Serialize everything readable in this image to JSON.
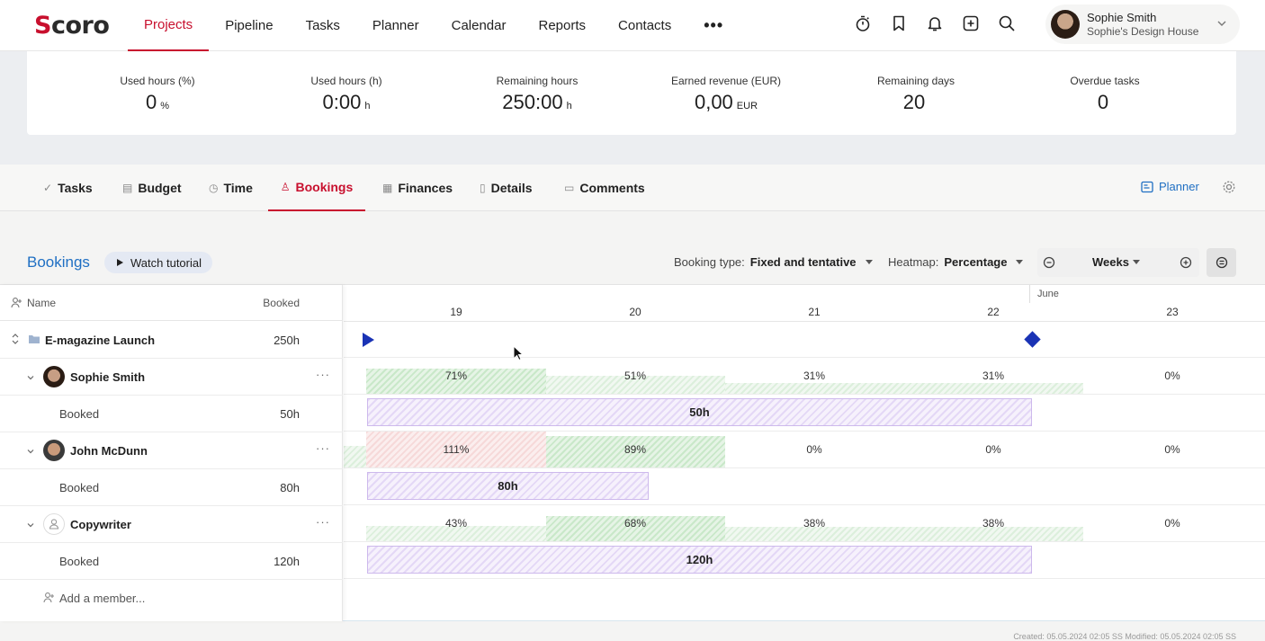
{
  "app": {
    "logo_s": "S",
    "logo_rest": "coro"
  },
  "nav": {
    "items": [
      "Projects",
      "Pipeline",
      "Tasks",
      "Planner",
      "Calendar",
      "Reports",
      "Contacts"
    ],
    "more": "•••",
    "active": "Projects"
  },
  "top_icons": [
    "stopwatch-icon",
    "bookmark-icon",
    "bell-icon",
    "add-icon",
    "search-icon"
  ],
  "user": {
    "name": "Sophie Smith",
    "company": "Sophie's Design House"
  },
  "stats": [
    {
      "label": "Used hours (%)",
      "value": "0",
      "unit": "%"
    },
    {
      "label": "Used hours (h)",
      "value": "0:00",
      "unit": "h"
    },
    {
      "label": "Remaining hours",
      "value": "250:00",
      "unit": "h"
    },
    {
      "label": "Earned revenue (EUR)",
      "value": "0,00",
      "unit": "EUR"
    },
    {
      "label": "Remaining days",
      "value": "20",
      "unit": ""
    },
    {
      "label": "Overdue tasks",
      "value": "0",
      "unit": ""
    }
  ],
  "tabs": [
    "Tasks",
    "Budget",
    "Time",
    "Bookings",
    "Finances",
    "Details",
    "Comments"
  ],
  "active_tab": "Bookings",
  "planner_link": "Planner",
  "bookings": {
    "title": "Bookings",
    "tutorial": "Watch tutorial",
    "booking_type_label": "Booking type:",
    "booking_type_value": "Fixed and tentative",
    "heatmap_label": "Heatmap:",
    "heatmap_value": "Percentage",
    "period": "Weeks"
  },
  "grid": {
    "col_name": "Name",
    "col_booked": "Booked",
    "month": "June",
    "weeks": [
      "19",
      "20",
      "21",
      "22",
      "23"
    ],
    "project": {
      "name": "E-magazine Launch",
      "hours": "250h"
    },
    "members": [
      {
        "name": "Sophie Smith",
        "booked_label": "Booked",
        "booked": "50h",
        "bar_label": "50h",
        "pcts": [
          "71%",
          "51%",
          "31%",
          "31%",
          "0%"
        ]
      },
      {
        "name": "John McDunn",
        "booked_label": "Booked",
        "booked": "80h",
        "bar_label": "80h",
        "pcts": [
          "111%",
          "89%",
          "0%",
          "0%",
          "0%"
        ]
      },
      {
        "name": "Copywriter",
        "booked_label": "Booked",
        "booked": "120h",
        "bar_label": "120h",
        "pcts": [
          "43%",
          "68%",
          "38%",
          "38%",
          "0%"
        ]
      }
    ],
    "add_member": "Add a member..."
  },
  "footer": "Created: 05.05.2024 02:05 SS    Modified: 05.05.2024 02:05 SS",
  "colors": {
    "accent": "#c8102e",
    "link": "#1f6fc3",
    "marker": "#1a33b5",
    "bar": "#e4d8f6"
  }
}
